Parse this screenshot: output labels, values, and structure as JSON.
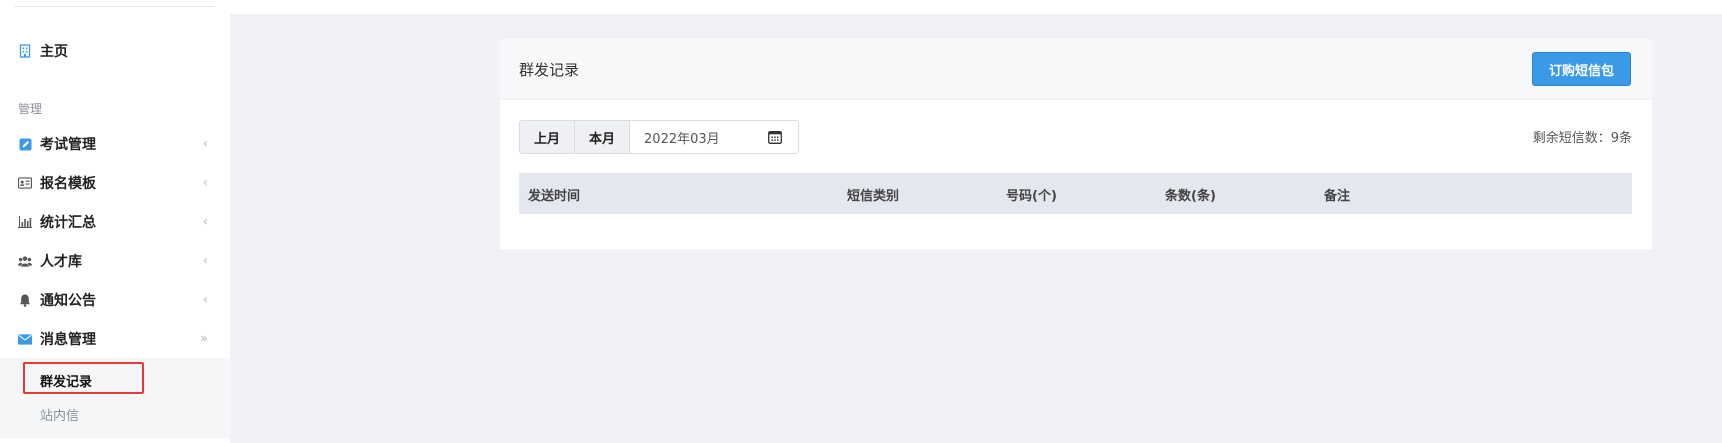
{
  "sidebar": {
    "home_label": "主页",
    "section_label": "管理",
    "items": [
      {
        "label": "考试管理",
        "icon": "edit-icon"
      },
      {
        "label": "报名模板",
        "icon": "id-card-icon"
      },
      {
        "label": "统计汇总",
        "icon": "bar-chart-icon"
      },
      {
        "label": "人才库",
        "icon": "users-icon"
      },
      {
        "label": "通知公告",
        "icon": "bell-icon"
      },
      {
        "label": "消息管理",
        "icon": "envelope-icon"
      }
    ],
    "submenu": [
      {
        "label": "群发记录",
        "active": true
      },
      {
        "label": "站内信",
        "active": false
      }
    ]
  },
  "card": {
    "title": "群发记录",
    "buy_button": "订购短信包",
    "filter": {
      "last_month": "上月",
      "this_month": "本月",
      "date_value": "2022年03月"
    },
    "remaining": "剩余短信数：9条",
    "table": {
      "columns": [
        "发送时间",
        "短信类别",
        "号码(个)",
        "条数(条)",
        "备注"
      ]
    }
  },
  "colors": {
    "accent": "#3a9ae8",
    "highlight": "#e53935",
    "table_header_bg": "#e4e7ee"
  }
}
